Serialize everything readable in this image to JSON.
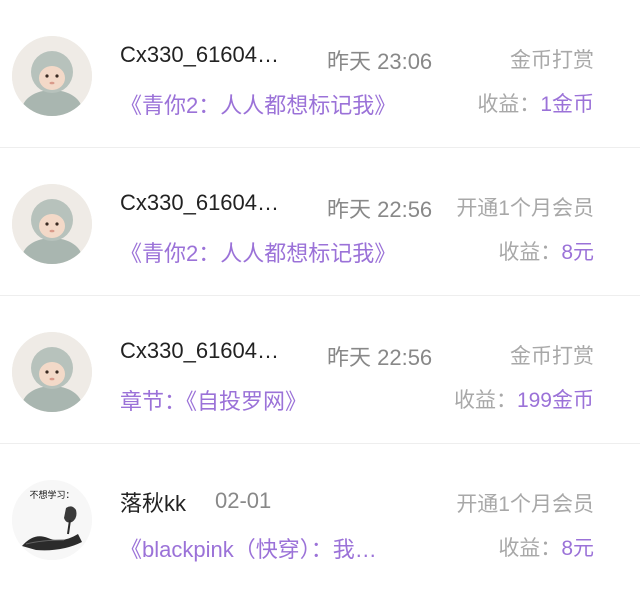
{
  "records": [
    {
      "user": "Cx330_61604…",
      "time": "昨天 23:06",
      "type": "金币打赏",
      "subject": "《青你2：人人都想标记我》",
      "income_label": "收益：",
      "income_value": "1金币",
      "avatar": "baby-avatar-icon"
    },
    {
      "user": "Cx330_61604…",
      "time": "昨天 22:56",
      "type": "开通1个月会员",
      "subject": "《青你2：人人都想标记我》",
      "income_label": "收益：",
      "income_value": "8元",
      "avatar": "baby-avatar-icon"
    },
    {
      "user": "Cx330_61604…",
      "time": "昨天 22:56",
      "type": "金币打赏",
      "subject": "章节：《自投罗网》",
      "income_label": "收益：",
      "income_value": "199金币",
      "avatar": "baby-avatar-icon"
    },
    {
      "user": "落秋kk",
      "time": "02-01",
      "type": "开通1个月会员",
      "subject": "《blackpink（快穿）：我…",
      "income_label": "收益：",
      "income_value": "8元",
      "avatar": "sketch-avatar-icon",
      "avatar_text": "不想学习："
    }
  ],
  "colors": {
    "accent": "#9b72d8",
    "primary_text": "#222222",
    "secondary_text": "#888888",
    "muted_text": "#a8a8a8",
    "divider": "#eeeeee"
  }
}
